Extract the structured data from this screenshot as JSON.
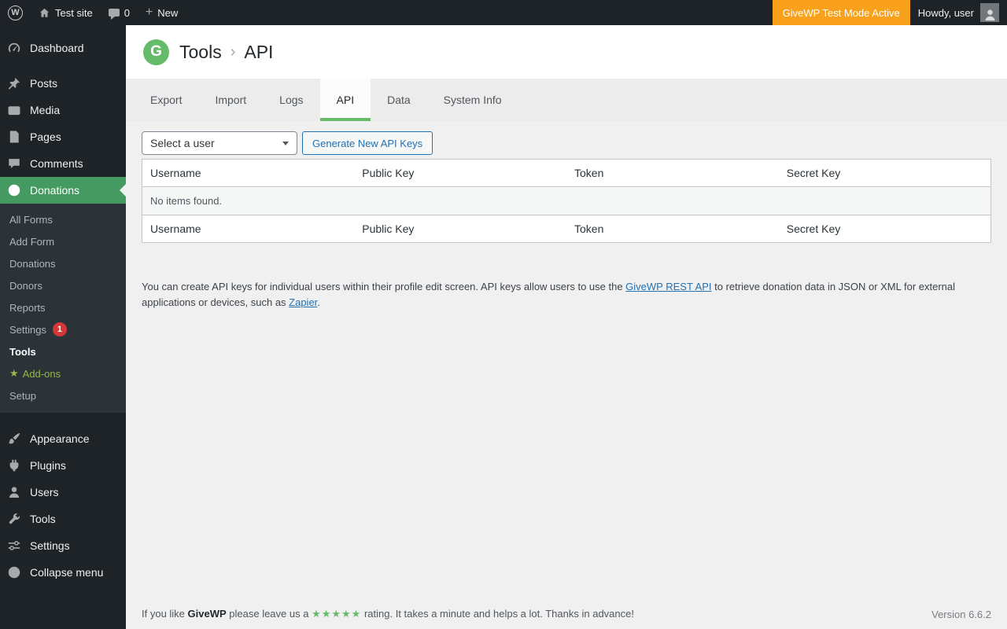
{
  "colors": {
    "brand_green": "#66bb6a",
    "active_menu_green": "#459a62",
    "link_blue": "#2271b1",
    "test_mode_orange": "#f9a11b",
    "badge_red": "#d63638",
    "addons_green": "#96b844"
  },
  "admin_bar": {
    "wp_glyph": "W",
    "site_name": "Test site",
    "comments_count": "0",
    "new_label": "New",
    "test_mode": "GiveWP Test Mode Active",
    "greeting": "Howdy, user"
  },
  "sidebar": {
    "items": [
      {
        "label": "Dashboard"
      },
      {
        "label": "Posts"
      },
      {
        "label": "Media"
      },
      {
        "label": "Pages"
      },
      {
        "label": "Comments"
      },
      {
        "label": "Donations"
      },
      {
        "label": "Appearance"
      },
      {
        "label": "Plugins"
      },
      {
        "label": "Users"
      },
      {
        "label": "Tools"
      },
      {
        "label": "Settings"
      },
      {
        "label": "Collapse menu"
      }
    ],
    "submenu": {
      "items": [
        {
          "label": "All Forms"
        },
        {
          "label": "Add Form"
        },
        {
          "label": "Donations"
        },
        {
          "label": "Donors"
        },
        {
          "label": "Reports"
        },
        {
          "label": "Settings",
          "badge": "1"
        },
        {
          "label": "Tools"
        },
        {
          "label": "Add-ons",
          "star": "★"
        },
        {
          "label": "Setup"
        }
      ]
    }
  },
  "page_header": {
    "logo_glyph": "G",
    "title": "Tools",
    "separator": "›",
    "subtitle": "API"
  },
  "tabs": [
    {
      "label": "Export"
    },
    {
      "label": "Import"
    },
    {
      "label": "Logs"
    },
    {
      "label": "API"
    },
    {
      "label": "Data"
    },
    {
      "label": "System Info"
    }
  ],
  "api": {
    "select_value": "Select a user",
    "generate_label": "Generate New API Keys",
    "headers": [
      "Username",
      "Public Key",
      "Token",
      "Secret Key"
    ],
    "empty_message": "No items found.",
    "description": {
      "p1": "You can create API keys for individual users within their profile edit screen. API keys allow users to use the ",
      "link1": "GiveWP REST API",
      "p2": " to retrieve donation data in JSON or XML for external applications or devices, such as ",
      "link2": "Zapier",
      "p3": "."
    }
  },
  "footer": {
    "p1": "If you like ",
    "brand": "GiveWP",
    "p2": " please leave us a ",
    "stars": "★★★★★",
    "p3": " rating. It takes a minute and helps a lot. Thanks in advance!",
    "version": "Version 6.6.2"
  }
}
